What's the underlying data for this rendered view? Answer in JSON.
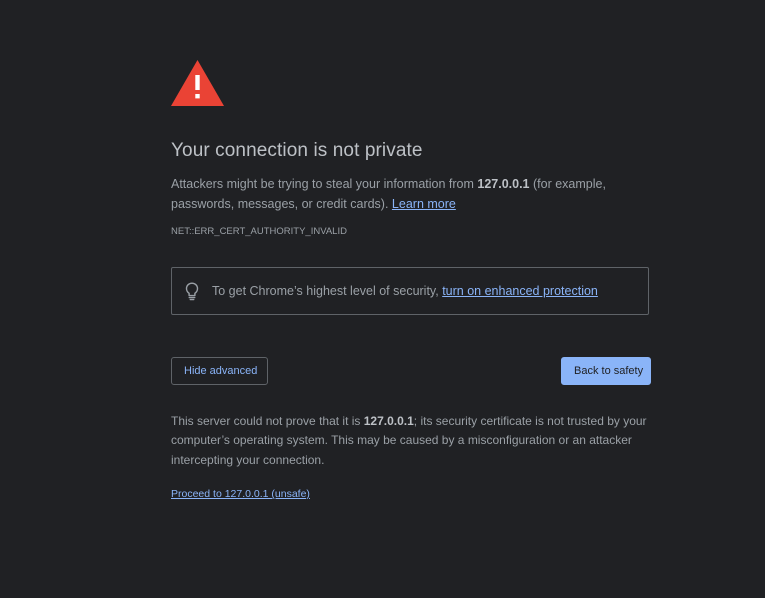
{
  "page": {
    "title": "Your connection is not private",
    "explanation": {
      "before_host": "Attackers might be trying to steal your information from ",
      "host": "127.0.0.1",
      "after_host": " (for example, passwords, messages, or credit cards). ",
      "learn_more": "Learn more"
    },
    "error_code": "NET::ERR_CERT_AUTHORITY_INVALID",
    "enhanced_protection": {
      "icon": "lightbulb-icon",
      "text": "To get Chrome’s highest level of security, ",
      "link": "turn on enhanced protection"
    },
    "buttons": {
      "hide_advanced": "Hide advanced",
      "back_to_safety": "Back to safety"
    },
    "details": {
      "before_host": "This server could not prove that it is ",
      "host": "127.0.0.1",
      "after_host": "; its security certificate is not trusted by your computer’s operating system. This may be caused by a misconfiguration or an attacker intercepting your connection."
    },
    "proceed_link": "Proceed to 127.0.0.1 (unsafe)"
  },
  "colors": {
    "background": "#202124",
    "warning": "#ea4335",
    "link": "#8ab4f8",
    "text": "#9aa0a6",
    "heading": "#bdc1c6",
    "border": "#5f6368"
  }
}
